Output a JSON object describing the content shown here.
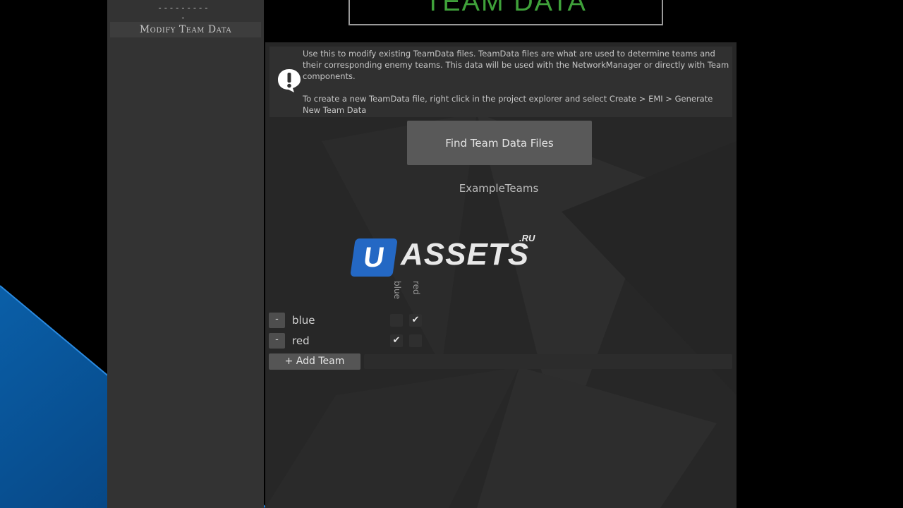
{
  "sidebar": {
    "divider": "----------",
    "items": [
      {
        "label": "Modify Team Data"
      }
    ]
  },
  "header": {
    "title": "TEAM DATA"
  },
  "help": {
    "paragraph1": "Use this to modify existing TeamData files. TeamData files are what are used to determine teams and their corresponding enemy teams. This data will be used with the NetworkManager or directly with Team components.",
    "paragraph2": "To create a new TeamData file, right click in the project explorer and select Create > EMI > Generate New Team Data"
  },
  "find_button": {
    "label": "Find Team Data Files"
  },
  "file_name": "ExampleTeams",
  "watermark": {
    "u": "U",
    "assets": "ASSETS",
    "ru": ".RU"
  },
  "teams": {
    "columns": [
      "blue",
      "red"
    ],
    "rows": [
      {
        "remove_label": "-",
        "name": "blue",
        "checks": [
          false,
          true
        ]
      },
      {
        "remove_label": "-",
        "name": "red",
        "checks": [
          true,
          false
        ]
      }
    ],
    "check_glyph": "✔",
    "add_label": "+ Add Team"
  },
  "colors": {
    "title_green": "#3fa13a",
    "sidebar_bg": "#333333",
    "panel_bg": "#272727",
    "button_bg": "#595959",
    "watermark_blue": "#2468c4",
    "wedge_blue": "#0a5fa8"
  },
  "icons": {
    "help": "exclamation-speech-bubble-icon",
    "check": "checkmark-icon"
  }
}
